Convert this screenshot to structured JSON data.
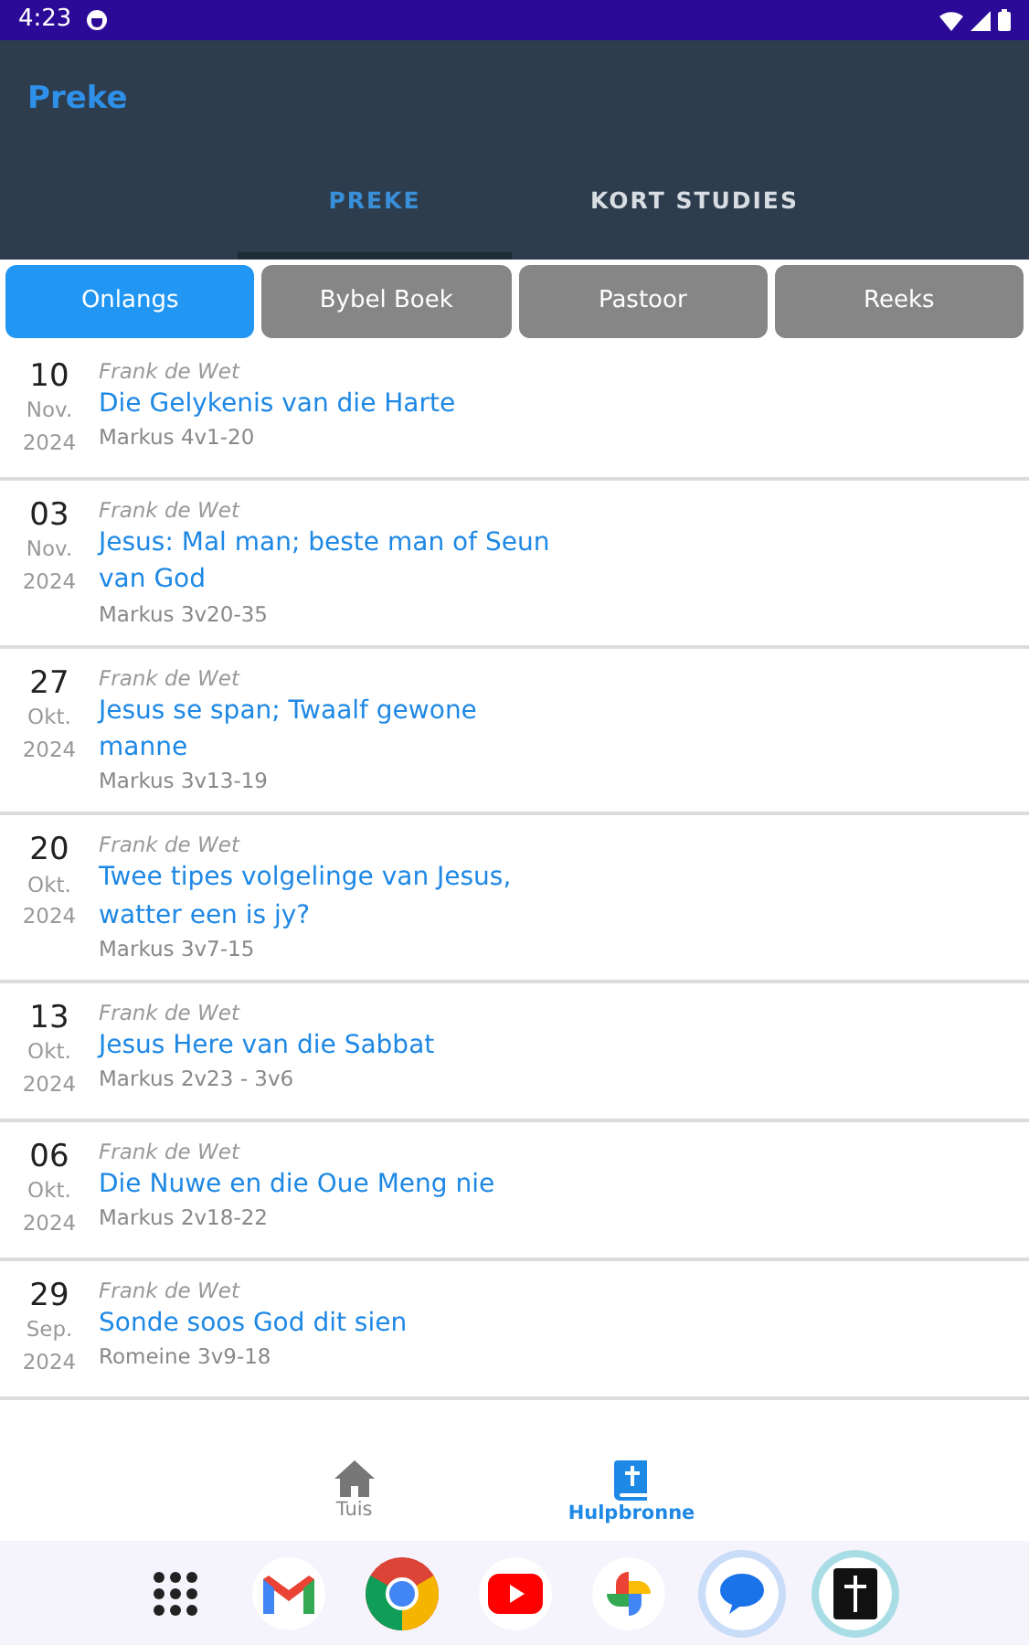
{
  "status_bar": {
    "time": "4:23"
  },
  "app_bar": {
    "title": "Preke"
  },
  "tabs": [
    {
      "label": "PREKE",
      "selected": true
    },
    {
      "label": "KORT STUDIES",
      "selected": false
    }
  ],
  "filters": [
    {
      "label": "Onlangs",
      "selected": true
    },
    {
      "label": "Bybel Boek",
      "selected": false
    },
    {
      "label": "Pastoor",
      "selected": false
    },
    {
      "label": "Reeks",
      "selected": false
    }
  ],
  "sermons": [
    {
      "day": "10",
      "month": "Nov.",
      "year": "2024",
      "speaker": "Frank de Wet",
      "title": "Die Gelykenis van die Harte",
      "passage": "Markus 4v1-20"
    },
    {
      "day": "03",
      "month": "Nov.",
      "year": "2024",
      "speaker": "Frank de Wet",
      "title": "Jesus: Mal man; beste man of Seun van God",
      "passage": "Markus 3v20-35"
    },
    {
      "day": "27",
      "month": "Okt.",
      "year": "2024",
      "speaker": "Frank de Wet",
      "title": "Jesus se span; Twaalf gewone manne",
      "passage": "Markus 3v13-19"
    },
    {
      "day": "20",
      "month": "Okt.",
      "year": "2024",
      "speaker": "Frank de Wet",
      "title": "Twee tipes volgelinge van Jesus, watter een is jy?",
      "passage": "Markus 3v7-15"
    },
    {
      "day": "13",
      "month": "Okt.",
      "year": "2024",
      "speaker": "Frank de Wet",
      "title": "Jesus Here van die Sabbat",
      "passage": "Markus 2v23 - 3v6"
    },
    {
      "day": "06",
      "month": "Okt.",
      "year": "2024",
      "speaker": "Frank de Wet",
      "title": "Die Nuwe en die Oue Meng nie",
      "passage": "Markus 2v18-22"
    },
    {
      "day": "29",
      "month": "Sep.",
      "year": "2024",
      "speaker": "Frank de Wet",
      "title": "Sonde soos God dit sien",
      "passage": "Romeine 3v9-18"
    }
  ],
  "bottom_nav": [
    {
      "label": "Tuis",
      "kind": "home",
      "selected": false
    },
    {
      "label": "Hulpbronne",
      "kind": "book",
      "selected": true
    }
  ],
  "dock": [
    {
      "kind": "apps"
    },
    {
      "kind": "mail"
    },
    {
      "kind": "browser"
    },
    {
      "kind": "video"
    },
    {
      "kind": "photos"
    },
    {
      "kind": "chat"
    },
    {
      "kind": "cross"
    }
  ]
}
